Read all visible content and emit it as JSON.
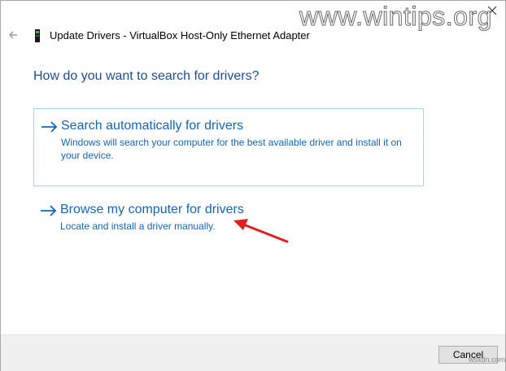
{
  "window": {
    "title": "Update Drivers - VirtualBox Host-Only Ethernet Adapter",
    "close_icon": "close-icon",
    "back_icon": "back-arrow-icon",
    "device_icon": "network-adapter-icon"
  },
  "watermark": {
    "text": "www.wintips.org",
    "small_text": "wsxdn.com"
  },
  "main": {
    "heading": "How do you want to search for drivers?",
    "options": [
      {
        "title": "Search automatically for drivers",
        "description": "Windows will search your computer for the best available driver and install it on your device.",
        "icon": "arrow-right-icon"
      },
      {
        "title": "Browse my computer for drivers",
        "description": "Locate and install a driver manually.",
        "icon": "arrow-right-icon"
      }
    ]
  },
  "footer": {
    "cancel_label": "Cancel"
  },
  "colors": {
    "link_blue": "#1565b5",
    "heading_blue": "#1f4e8c",
    "option_border": "#a8d2f0",
    "annotation_red": "#e02020",
    "footer_bg": "#f0f0f0"
  }
}
